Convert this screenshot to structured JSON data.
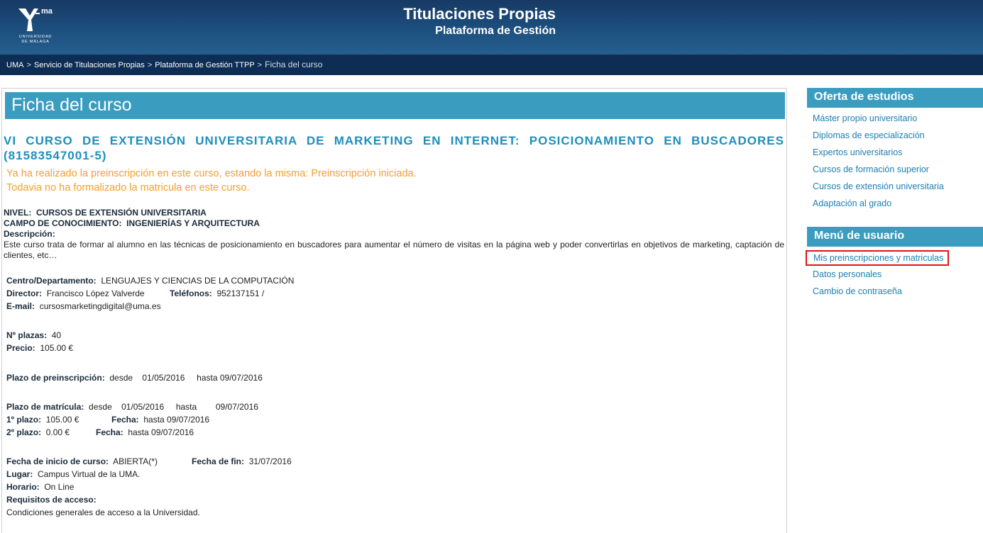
{
  "header": {
    "logo_ma": "ma",
    "logo_text": [
      "UNIVERSIDAD",
      "DE MÁLAGA"
    ],
    "title": "Titulaciones Propias",
    "subtitle": "Plataforma de Gestión"
  },
  "breadcrumb": {
    "items": [
      "UMA",
      "Servicio de Titulaciones Propias",
      "Plataforma de Gestión TTPP"
    ],
    "separator": ">",
    "current": "Ficha del curso"
  },
  "page": {
    "title": "Ficha del curso",
    "course_title": "VI CURSO DE EXTENSIÓN UNIVERSITARIA DE MARKETING EN INTERNET: POSICIONAMIENTO EN BUSCADORES (81583547001-5)",
    "status_line1": "Ya ha realizado la preinscripción en este curso, estando la misma: Preinscripción iniciada.",
    "status_line2": "Todavia no ha formalizado la matricula en este curso.",
    "nivel_label": "NIVEL:",
    "nivel_value": "CURSOS DE EXTENSIÓN UNIVERSITARIA",
    "campo_label": "CAMPO DE CONOCIMIENTO:",
    "campo_value": "INGENIERÍAS Y ARQUITECTURA",
    "descripcion_label": "Descripción:",
    "descripcion": "Este curso trata de formar al alumno en las técnicas de posicionamiento en buscadores para aumentar el número de visitas en la página web y poder convertirlas en objetivos de marketing, captación de clientes, etc…",
    "centro_label": "Centro/Departamento:",
    "centro_value": "LENGUAJES Y CIENCIAS DE LA COMPUTACIÓN",
    "director_label": "Director:",
    "director_value": "Francisco López Valverde",
    "telefonos_label": "Teléfonos:",
    "telefonos_value": "952137151  /",
    "email_label": "E-mail:",
    "email_value": "cursosmarketingdigital@uma.es",
    "plazas_label": "Nº plazas:",
    "plazas_value": "40",
    "precio_label": "Precio:",
    "precio_value": "105.00 €",
    "preinscripcion_label": "Plazo de preinscripción:",
    "preinscripcion_desde": "desde",
    "preinscripcion_desde_fecha": "01/05/2016",
    "preinscripcion_hasta": "hasta 09/07/2016",
    "matricula_label": "Plazo de matrícula:",
    "matricula_desde": "desde",
    "matricula_desde_fecha": "01/05/2016",
    "matricula_hasta": "hasta",
    "matricula_hasta_fecha": "09/07/2016",
    "plazo1_label": "1º plazo:",
    "plazo1_value": "105.00 €",
    "plazo1_fecha_label": "Fecha:",
    "plazo1_fecha_value": "hasta 09/07/2016",
    "plazo2_label": "2º plazo:",
    "plazo2_value": "0.00 €",
    "plazo2_fecha_label": "Fecha:",
    "plazo2_fecha_value": "hasta 09/07/2016",
    "inicio_label": "Fecha de inicio de curso:",
    "inicio_value": "ABIERTA(*)",
    "fin_label": "Fecha de fin:",
    "fin_value": "31/07/2016",
    "lugar_label": "Lugar:",
    "lugar_value": "Campus Virtual de la UMA.",
    "horario_label": "Horario:",
    "horario_value": "On Line",
    "requisitos_label": "Requisitos de acceso:",
    "requisitos_value": "Condiciones generales de acceso a la Universidad."
  },
  "sidebar": {
    "oferta_title": "Oferta de estudios",
    "oferta_items": [
      "Máster propio universitario",
      "Diplomas de especialización",
      "Expertos universitarios",
      "Cursos de formación superior",
      "Cursos de extensión universitaria",
      "Adaptación al grado"
    ],
    "usuario_title": "Menú de usuario",
    "usuario_items": [
      "Mis preinscripciones y matriculas",
      "Datos personales",
      "Cambio de contraseña"
    ]
  },
  "colors": {
    "header_bg": "#1d4f7e",
    "crumb_bg": "#0e2d55",
    "accent": "#3a9dbf",
    "course_title": "#1d8fbe",
    "status": "#f2a02c",
    "link": "#1d7fb2",
    "highlight_border": "#e3101a"
  }
}
